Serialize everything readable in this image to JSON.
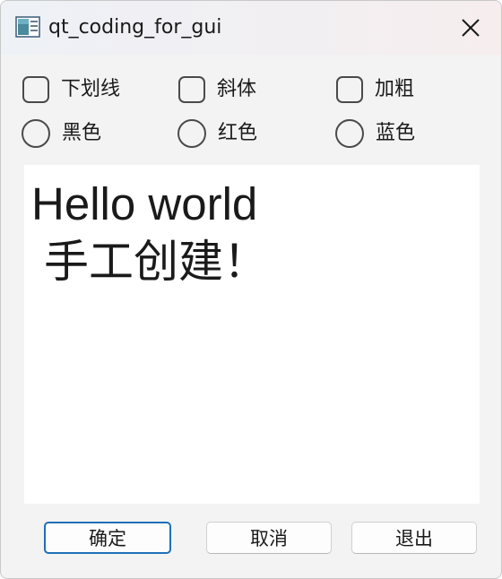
{
  "window": {
    "title": "qt_coding_for_gui"
  },
  "checkboxes": [
    {
      "label": "下划线",
      "checked": false
    },
    {
      "label": "斜体",
      "checked": false
    },
    {
      "label": "加粗",
      "checked": false
    }
  ],
  "radios": [
    {
      "label": "黑色",
      "selected": false
    },
    {
      "label": "红色",
      "selected": false
    },
    {
      "label": "蓝色",
      "selected": false
    }
  ],
  "editor": {
    "line1": "Hello world",
    "line2": "手工创建！"
  },
  "buttons": {
    "ok": "确定",
    "cancel": "取消",
    "exit": "退出"
  },
  "icons": {
    "app": "app-window-icon",
    "close": "close-icon"
  }
}
